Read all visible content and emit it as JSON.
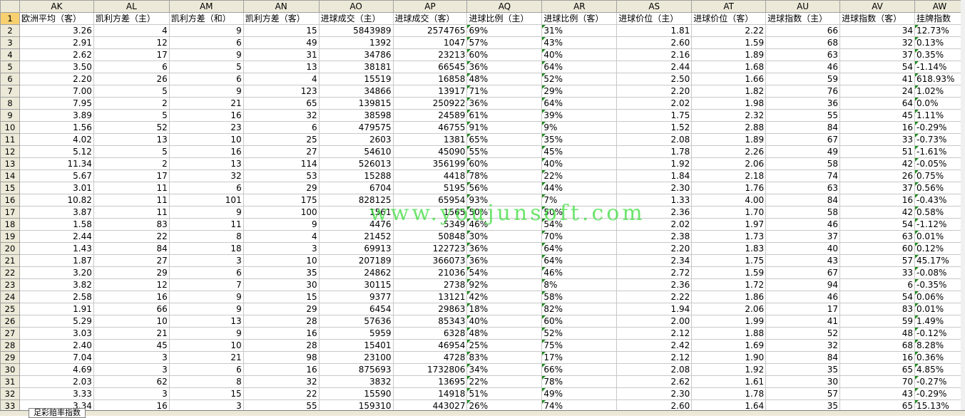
{
  "columns": [
    "AK",
    "AL",
    "AM",
    "AN",
    "AO",
    "AP",
    "AQ",
    "AR",
    "AS",
    "AT",
    "AU",
    "AV",
    "AW"
  ],
  "header_row_number": "1",
  "headers": [
    "欧洲平均（客）",
    "凯利方差（主）",
    "凯利方差（和）",
    "凯利方差（客）",
    "进球成交（主）",
    "进球成交（客）",
    "进球比例（主）",
    "进球比例（客）",
    "进球价位（主）",
    "进球价位（客）",
    "进球指数（主）",
    "进球指数（客）",
    "挂牌指数"
  ],
  "rows": [
    {
      "n": "2",
      "c": [
        "3.26",
        "4",
        "9",
        "15",
        "5843989",
        "2574765",
        "69%",
        "31%",
        "1.81",
        "2.22",
        "66",
        "34",
        "12.73%"
      ]
    },
    {
      "n": "3",
      "c": [
        "2.91",
        "12",
        "6",
        "49",
        "1392",
        "1047",
        "57%",
        "43%",
        "2.60",
        "1.59",
        "68",
        "32",
        "0.13%"
      ]
    },
    {
      "n": "4",
      "c": [
        "2.62",
        "17",
        "9",
        "31",
        "34786",
        "23213",
        "60%",
        "40%",
        "2.16",
        "1.89",
        "63",
        "37",
        "0.35%"
      ]
    },
    {
      "n": "5",
      "c": [
        "3.50",
        "6",
        "5",
        "13",
        "38181",
        "66545",
        "36%",
        "64%",
        "2.44",
        "1.68",
        "46",
        "54",
        "-1.14%"
      ]
    },
    {
      "n": "6",
      "c": [
        "2.20",
        "26",
        "6",
        "4",
        "15519",
        "16858",
        "48%",
        "52%",
        "2.50",
        "1.66",
        "59",
        "41",
        "618.93%"
      ]
    },
    {
      "n": "7",
      "c": [
        "7.00",
        "5",
        "9",
        "123",
        "34866",
        "13917",
        "71%",
        "29%",
        "2.20",
        "1.82",
        "76",
        "24",
        "1.02%"
      ]
    },
    {
      "n": "8",
      "c": [
        "7.95",
        "2",
        "21",
        "65",
        "139815",
        "250922",
        "36%",
        "64%",
        "2.02",
        "1.98",
        "36",
        "64",
        "0.0%"
      ]
    },
    {
      "n": "9",
      "c": [
        "3.89",
        "5",
        "16",
        "32",
        "38598",
        "24589",
        "61%",
        "39%",
        "1.75",
        "2.32",
        "55",
        "45",
        "1.11%"
      ]
    },
    {
      "n": "10",
      "c": [
        "1.56",
        "52",
        "23",
        "6",
        "479575",
        "46755",
        "91%",
        "9%",
        "1.52",
        "2.88",
        "84",
        "16",
        "-0.29%"
      ]
    },
    {
      "n": "11",
      "c": [
        "4.02",
        "13",
        "10",
        "25",
        "2603",
        "1381",
        "65%",
        "35%",
        "2.08",
        "1.89",
        "67",
        "33",
        "-0.73%"
      ]
    },
    {
      "n": "12",
      "c": [
        "5.12",
        "5",
        "16",
        "27",
        "54610",
        "45090",
        "55%",
        "45%",
        "1.78",
        "2.26",
        "49",
        "51",
        "-1.61%"
      ]
    },
    {
      "n": "13",
      "c": [
        "11.34",
        "2",
        "13",
        "114",
        "526013",
        "356199",
        "60%",
        "40%",
        "1.92",
        "2.06",
        "58",
        "42",
        "-0.05%"
      ]
    },
    {
      "n": "14",
      "c": [
        "5.67",
        "17",
        "32",
        "53",
        "15288",
        "4418",
        "78%",
        "22%",
        "1.84",
        "2.18",
        "74",
        "26",
        "0.75%"
      ]
    },
    {
      "n": "15",
      "c": [
        "3.01",
        "11",
        "6",
        "29",
        "6704",
        "5195",
        "56%",
        "44%",
        "2.30",
        "1.76",
        "63",
        "37",
        "0.56%"
      ]
    },
    {
      "n": "16",
      "c": [
        "10.82",
        "11",
        "101",
        "175",
        "828125",
        "65954",
        "93%",
        "7%",
        "1.33",
        "4.00",
        "84",
        "16",
        "-0.43%"
      ]
    },
    {
      "n": "17",
      "c": [
        "3.87",
        "11",
        "9",
        "100",
        "1561",
        "1565",
        "50%",
        "50%",
        "2.36",
        "1.70",
        "58",
        "42",
        "0.58%"
      ]
    },
    {
      "n": "18",
      "c": [
        "1.58",
        "83",
        "11",
        "9",
        "4476",
        "5349",
        "46%",
        "54%",
        "2.02",
        "1.97",
        "46",
        "54",
        "-1.12%"
      ]
    },
    {
      "n": "19",
      "c": [
        "2.44",
        "22",
        "8",
        "4",
        "21452",
        "50848",
        "30%",
        "70%",
        "2.38",
        "1.73",
        "37",
        "63",
        "0.01%"
      ]
    },
    {
      "n": "20",
      "c": [
        "1.43",
        "84",
        "18",
        "3",
        "69913",
        "122723",
        "36%",
        "64%",
        "2.20",
        "1.83",
        "40",
        "60",
        "0.12%"
      ]
    },
    {
      "n": "21",
      "c": [
        "1.87",
        "27",
        "3",
        "10",
        "207189",
        "366073",
        "36%",
        "64%",
        "2.34",
        "1.75",
        "43",
        "57",
        "45.17%"
      ]
    },
    {
      "n": "22",
      "c": [
        "3.20",
        "29",
        "6",
        "35",
        "24862",
        "21036",
        "54%",
        "46%",
        "2.72",
        "1.59",
        "67",
        "33",
        "-0.08%"
      ]
    },
    {
      "n": "23",
      "c": [
        "3.82",
        "12",
        "7",
        "30",
        "30115",
        "2738",
        "92%",
        "8%",
        "2.36",
        "1.72",
        "94",
        "6",
        "-0.35%"
      ]
    },
    {
      "n": "24",
      "c": [
        "2.58",
        "16",
        "9",
        "15",
        "9377",
        "13121",
        "42%",
        "58%",
        "2.22",
        "1.86",
        "46",
        "54",
        "0.06%"
      ]
    },
    {
      "n": "25",
      "c": [
        "1.91",
        "66",
        "9",
        "29",
        "6454",
        "29863",
        "18%",
        "82%",
        "1.94",
        "2.06",
        "17",
        "83",
        "0.01%"
      ]
    },
    {
      "n": "26",
      "c": [
        "5.29",
        "10",
        "13",
        "28",
        "57636",
        "85343",
        "40%",
        "60%",
        "2.00",
        "1.99",
        "41",
        "59",
        "1.49%"
      ]
    },
    {
      "n": "27",
      "c": [
        "3.03",
        "21",
        "9",
        "16",
        "5959",
        "6328",
        "48%",
        "52%",
        "2.12",
        "1.88",
        "52",
        "48",
        "-0.12%"
      ]
    },
    {
      "n": "28",
      "c": [
        "2.40",
        "45",
        "10",
        "28",
        "15401",
        "46954",
        "25%",
        "75%",
        "2.42",
        "1.69",
        "32",
        "68",
        "8.28%"
      ]
    },
    {
      "n": "29",
      "c": [
        "7.04",
        "3",
        "21",
        "98",
        "23100",
        "4728",
        "83%",
        "17%",
        "2.12",
        "1.90",
        "84",
        "16",
        "0.36%"
      ]
    },
    {
      "n": "30",
      "c": [
        "4.69",
        "3",
        "6",
        "16",
        "875693",
        "1732806",
        "34%",
        "66%",
        "2.08",
        "1.92",
        "35",
        "65",
        "4.85%"
      ]
    },
    {
      "n": "31",
      "c": [
        "2.03",
        "62",
        "8",
        "32",
        "3832",
        "13695",
        "22%",
        "78%",
        "2.62",
        "1.61",
        "30",
        "70",
        "-0.27%"
      ]
    },
    {
      "n": "32",
      "c": [
        "3.33",
        "3",
        "15",
        "22",
        "15590",
        "14918",
        "51%",
        "49%",
        "2.30",
        "1.78",
        "57",
        "43",
        "-0.29%"
      ]
    },
    {
      "n": "33",
      "c": [
        "3.34",
        "16",
        "3",
        "55",
        "159310",
        "443027",
        "26%",
        "74%",
        "2.60",
        "1.64",
        "35",
        "65",
        "15.13%"
      ]
    }
  ],
  "watermark": "www.youjunsoft.com",
  "sheet_tab": "足彩赔率指数"
}
